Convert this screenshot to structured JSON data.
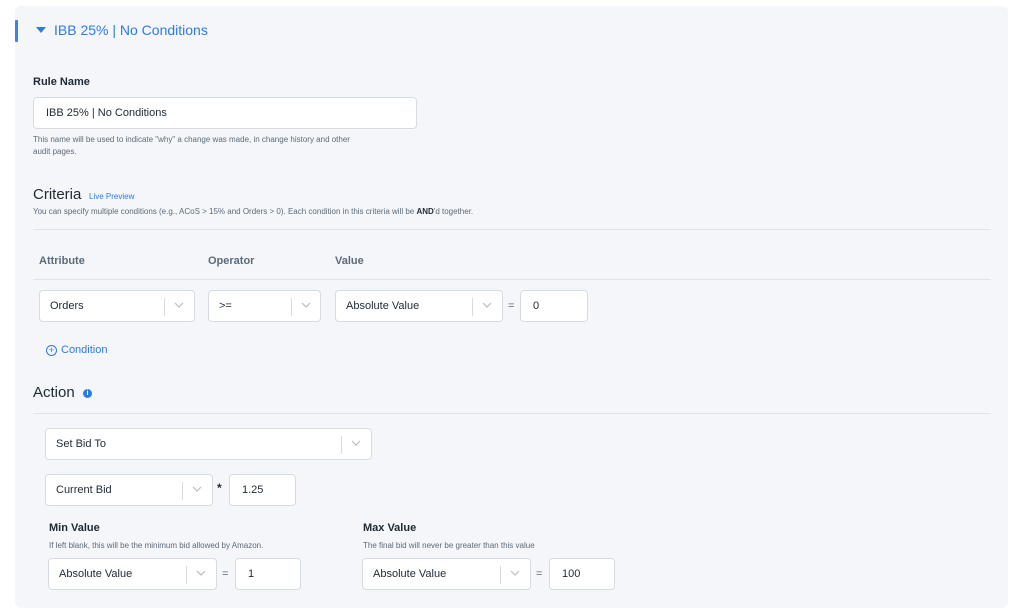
{
  "rule": {
    "section_title": "IBB 25% | No Conditions",
    "name_label": "Rule Name",
    "name_value": "IBB 25% | No Conditions",
    "name_help_line1": "This name will be used to indicate \"why\" a change was made, in change history and other",
    "name_help_line2": "audit pages."
  },
  "criteria": {
    "heading": "Criteria",
    "live_preview": "Live Preview",
    "help_prefix": "You can specify multiple conditions (e.g., ACoS > 15% and Orders > 0). Each condition in this criteria will be ",
    "help_bold": "AND",
    "help_suffix": "'d together.",
    "col_attribute": "Attribute",
    "col_operator": "Operator",
    "col_value": "Value",
    "row": {
      "attribute": "Orders",
      "operator": ">=",
      "value_type": "Absolute Value",
      "equals": "=",
      "value": "0"
    },
    "add_condition": "Condition",
    "add_icon": "plus-circle-icon"
  },
  "action": {
    "heading": "Action",
    "info_icon": "info-icon",
    "action_type": "Set Bid To",
    "base": "Current Bid",
    "multiply": "*",
    "multiplier": "1.25",
    "min_label": "Min Value",
    "min_help": "If left blank, this will be the minimum bid allowed by Amazon.",
    "min_type": "Absolute Value",
    "min_equals": "=",
    "min_value": "1",
    "max_label": "Max Value",
    "max_help": "The final bid will never be greater than this value",
    "max_type": "Absolute Value",
    "max_equals": "=",
    "max_value": "100"
  },
  "colors": {
    "accent": "#2c7be5",
    "panel_bg": "#f4f6f9",
    "border": "#d6dbe2"
  }
}
